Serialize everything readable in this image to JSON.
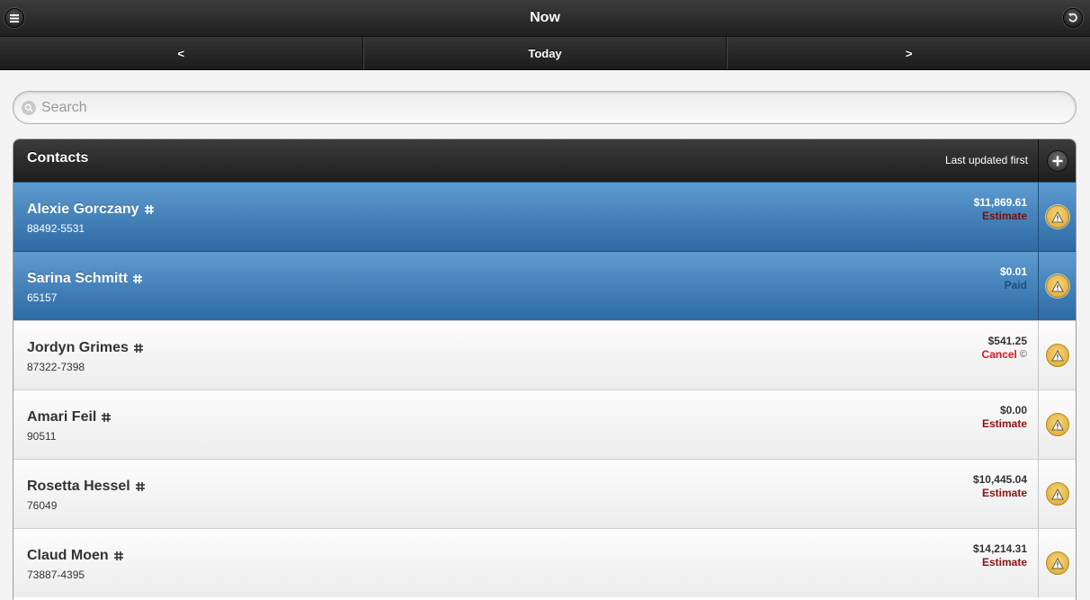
{
  "header": {
    "title": "Now",
    "menu_icon": "menu-icon",
    "refresh_icon": "refresh-icon"
  },
  "nav": {
    "prev_label": "<",
    "today_label": "Today",
    "next_label": ">"
  },
  "search": {
    "placeholder": "Search",
    "value": ""
  },
  "contacts": {
    "title": "Contacts",
    "sort_label": "Last updated first",
    "add_icon": "plus-icon",
    "rows": [
      {
        "name": "Alexie Gorczany",
        "phone": "88492-5531",
        "amount": "$11,869.61",
        "status": "Estimate",
        "status_type": "estimate",
        "selected": true
      },
      {
        "name": "Sarina Schmitt",
        "phone": "65157",
        "amount": "$0.01",
        "status": "Paid",
        "status_type": "paid",
        "selected": true
      },
      {
        "name": "Jordyn Grimes",
        "phone": "87322-7398",
        "amount": "$541.25",
        "status": "Cancel",
        "status_suffix": "©",
        "status_type": "cancel",
        "selected": false
      },
      {
        "name": "Amari Feil",
        "phone": "90511",
        "amount": "$0.00",
        "status": "Estimate",
        "status_type": "estimate",
        "selected": false
      },
      {
        "name": "Rosetta Hessel",
        "phone": "76049",
        "amount": "$10,445.04",
        "status": "Estimate",
        "status_type": "estimate",
        "selected": false
      },
      {
        "name": "Claud Moen",
        "phone": "73887-4395",
        "amount": "$14,214.31",
        "status": "Estimate",
        "status_type": "estimate",
        "selected": false
      }
    ]
  },
  "colors": {
    "selected_row": "#3f7fbf",
    "estimate": "#8b1111",
    "paid": "#1a5a8a",
    "cancel": "#e0151e",
    "warning": "#e8bd4f"
  }
}
